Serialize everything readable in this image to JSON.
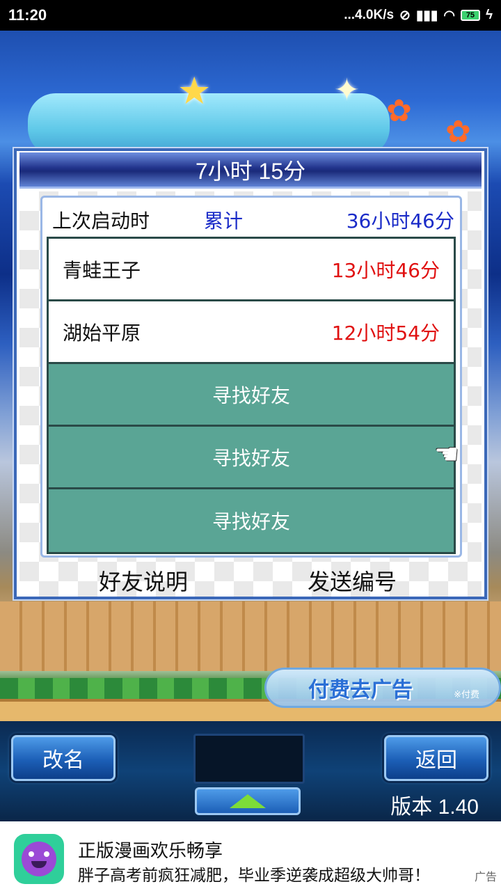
{
  "status_bar": {
    "time": "11:20",
    "network_speed": "...4.0K/s",
    "battery": "75"
  },
  "dialog": {
    "title": "7小时 15分",
    "summary": {
      "last_launch_label": "上次启动时",
      "total_label": "累计",
      "total_value": "36小时46分"
    },
    "friends": [
      {
        "name": "青蛙王子",
        "time": "13小时46分"
      },
      {
        "name": "湖始平原",
        "time": "12小时54分"
      }
    ],
    "find_friend_label": "寻找好友",
    "friend_help_label": "好友说明",
    "send_code_label": "发送编号"
  },
  "pay_ad": {
    "label": "付费去广告",
    "sub": "※付费"
  },
  "bottom_bar": {
    "rename_label": "改名",
    "back_label": "返回",
    "version": "版本 1.40"
  },
  "ad_banner": {
    "title": "正版漫画欢乐畅享",
    "description": "胖子高考前疯狂减肥，毕业季逆袭成超级大帅哥！",
    "tag": "广告"
  },
  "colors": {
    "teal_row": "#5aa595",
    "red_time": "#e01010",
    "blue_total": "#1a2bc8",
    "header_blue": "#22348c"
  }
}
